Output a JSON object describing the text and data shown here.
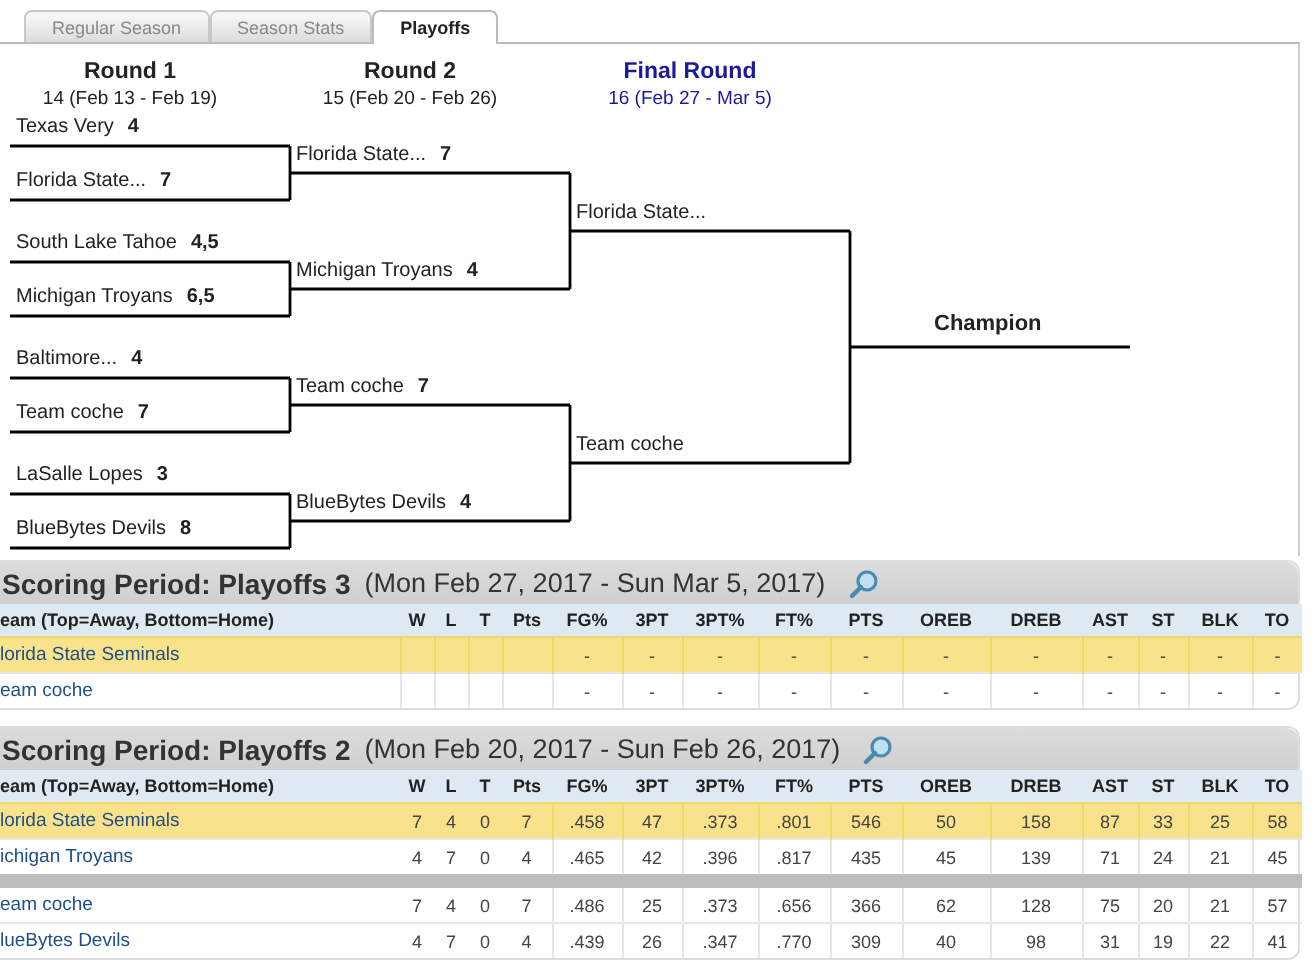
{
  "tabs": [
    {
      "label": "Regular Season",
      "selected": false
    },
    {
      "label": "Season Stats",
      "selected": false
    },
    {
      "label": "Playoffs",
      "selected": true
    }
  ],
  "bracket": {
    "rounds": [
      {
        "title": "Round 1",
        "dates": "14 (Feb 13 - Feb 19)",
        "current": false,
        "entries": [
          {
            "team": "Texas Very",
            "score": "4"
          },
          {
            "team": "Florida State...",
            "score": "7"
          },
          {
            "team": "South Lake Tahoe",
            "score": "4,5"
          },
          {
            "team": "Michigan Troyans",
            "score": "6,5"
          },
          {
            "team": "Baltimore...",
            "score": "4"
          },
          {
            "team": "Team coche",
            "score": "7"
          },
          {
            "team": "LaSalle Lopes",
            "score": "3"
          },
          {
            "team": "BlueBytes Devils",
            "score": "8"
          }
        ]
      },
      {
        "title": "Round 2",
        "dates": "15 (Feb 20 - Feb 26)",
        "current": false,
        "entries": [
          {
            "team": "Florida State...",
            "score": "7"
          },
          {
            "team": "Michigan Troyans",
            "score": "4"
          },
          {
            "team": "Team coche",
            "score": "7"
          },
          {
            "team": "BlueBytes Devils",
            "score": "4"
          }
        ]
      },
      {
        "title": "Final Round",
        "dates": "16 (Feb 27 - Mar 5)",
        "current": true,
        "entries": [
          {
            "team": "Florida State..."
          },
          {
            "team": "Team coche"
          }
        ]
      }
    ],
    "champion": "Champion"
  },
  "periods": [
    {
      "title": "Scoring Period: Playoffs 3",
      "dates": "(Mon Feb 27, 2017 - Sun Mar 5, 2017)",
      "columns": [
        "eam (Top=Away, Bottom=Home)",
        "W",
        "L",
        "T",
        "Pts",
        "FG%",
        "3PT",
        "3PT%",
        "FT%",
        "PTS",
        "OREB",
        "DREB",
        "AST",
        "ST",
        "BLK",
        "TO"
      ],
      "matchups": [
        [
          {
            "team": "lorida State Seminals",
            "highlighted": true,
            "stats": [
              "-",
              "-",
              "-",
              "-",
              "-",
              "-",
              "-",
              "-",
              "-",
              "-",
              "-"
            ]
          },
          {
            "team": "eam coche",
            "highlighted": false,
            "stats": [
              "-",
              "-",
              "-",
              "-",
              "-",
              "-",
              "-",
              "-",
              "-",
              "-",
              "-"
            ]
          }
        ]
      ]
    },
    {
      "title": "Scoring Period: Playoffs 2",
      "dates": "(Mon Feb 20, 2017 - Sun Feb 26, 2017)",
      "columns": [
        "eam (Top=Away, Bottom=Home)",
        "W",
        "L",
        "T",
        "Pts",
        "FG%",
        "3PT",
        "3PT%",
        "FT%",
        "PTS",
        "OREB",
        "DREB",
        "AST",
        "ST",
        "BLK",
        "TO"
      ],
      "matchups": [
        [
          {
            "team": "lorida State Seminals",
            "highlighted": true,
            "record": [
              "7",
              "4",
              "0",
              "7"
            ],
            "stats": [
              ".458",
              "47",
              ".373",
              ".801",
              "546",
              "50",
              "158",
              "87",
              "33",
              "25",
              "58"
            ]
          },
          {
            "team": "ichigan Troyans",
            "highlighted": false,
            "record": [
              "4",
              "7",
              "0",
              "4"
            ],
            "stats": [
              ".465",
              "42",
              ".396",
              ".817",
              "435",
              "45",
              "139",
              "71",
              "24",
              "21",
              "45"
            ]
          }
        ],
        [
          {
            "team": "eam coche",
            "highlighted": false,
            "record": [
              "7",
              "4",
              "0",
              "7"
            ],
            "stats": [
              ".486",
              "25",
              ".373",
              ".656",
              "366",
              "62",
              "128",
              "75",
              "20",
              "21",
              "57"
            ]
          },
          {
            "team": "lueBytes Devils",
            "highlighted": false,
            "record": [
              "4",
              "7",
              "0",
              "4"
            ],
            "stats": [
              ".439",
              "26",
              ".347",
              ".770",
              "309",
              "40",
              "98",
              "31",
              "19",
              "22",
              "41"
            ]
          }
        ]
      ]
    }
  ]
}
